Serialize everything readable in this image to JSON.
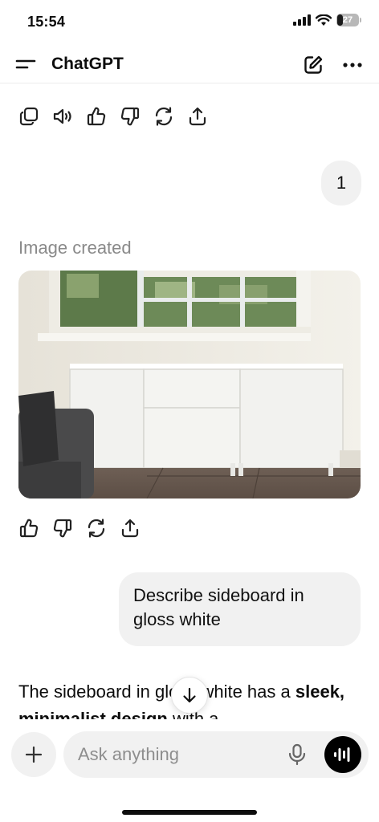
{
  "status": {
    "time": "15:54",
    "battery": "27",
    "battery_level": 0.27
  },
  "header": {
    "title": "ChatGPT"
  },
  "messages": {
    "user_1": "1",
    "image_label": "Image created",
    "user_2": "Describe sideboard in gloss white",
    "assistant_pre": "The sideboard in gloss white has a ",
    "assistant_bold": "sleek, minimalist design",
    "assistant_post": " with a"
  },
  "composer": {
    "placeholder": "Ask anything"
  },
  "icons": {
    "top_actions": [
      "copy-icon",
      "speaker-icon",
      "thumbs-up-icon",
      "thumbs-down-icon",
      "regenerate-icon",
      "share-icon"
    ],
    "image_actions": [
      "thumbs-up-icon",
      "thumbs-down-icon",
      "regenerate-icon",
      "share-icon"
    ]
  },
  "colors": {
    "bubble": "#f1f1f1",
    "muted_text": "#8a8a8a",
    "voice_button": "#000000"
  }
}
